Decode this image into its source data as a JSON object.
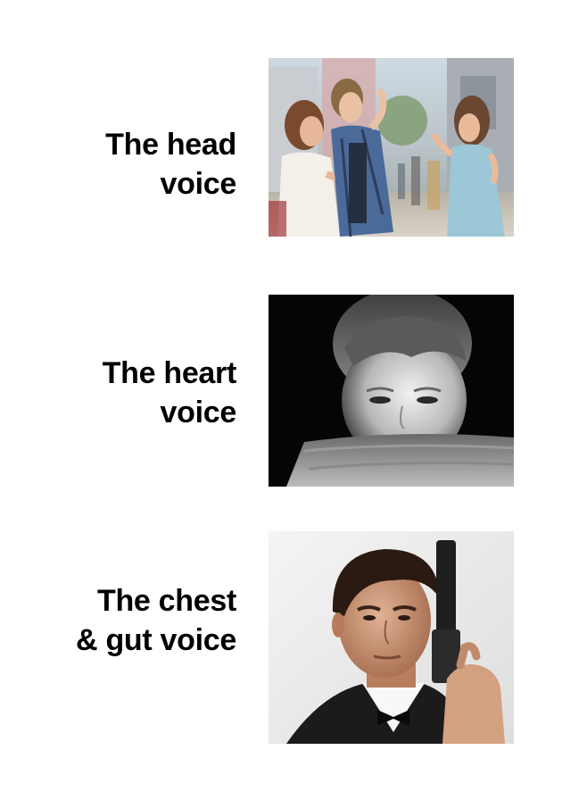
{
  "panels": [
    {
      "label_lines": [
        "The head",
        "voice"
      ],
      "image": "distracted-boyfriend-photo"
    },
    {
      "label_lines": [
        "The heart",
        "voice"
      ],
      "image": "sad-child-bw-photo"
    },
    {
      "label_lines": [
        "The chest",
        "& gut voice"
      ],
      "image": "man-in-tuxedo-with-pistol-photo"
    }
  ],
  "colors": {
    "background": "#ffffff",
    "text": "#000000"
  }
}
